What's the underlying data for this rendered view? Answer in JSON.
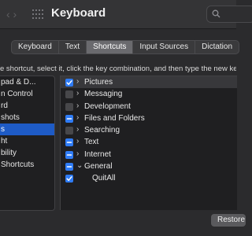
{
  "window": {
    "title": "Keyboard"
  },
  "tabs": [
    {
      "label": "Keyboard"
    },
    {
      "label": "Text"
    },
    {
      "label": "Shortcuts",
      "active": true
    },
    {
      "label": "Input Sources"
    },
    {
      "label": "Dictation"
    }
  ],
  "hint": "e shortcut, select it, click the key combination, and then type the new key",
  "left_list": [
    {
      "label": "pad & D..."
    },
    {
      "label": "n Control"
    },
    {
      "label": "rd"
    },
    {
      "label": "shots"
    },
    {
      "label": "s",
      "selected": true
    },
    {
      "label": "ht"
    },
    {
      "label": "bility"
    },
    {
      "label": "Shortcuts"
    }
  ],
  "right_list": [
    {
      "label": "Pictures",
      "state": "checked",
      "chevron": "›"
    },
    {
      "label": "Messaging",
      "state": "unchecked",
      "chevron": "›"
    },
    {
      "label": "Development",
      "state": "unchecked",
      "chevron": "›"
    },
    {
      "label": "Files and Folders",
      "state": "mixed",
      "chevron": "›"
    },
    {
      "label": "Searching",
      "state": "unchecked",
      "chevron": "›"
    },
    {
      "label": "Text",
      "state": "mixed",
      "chevron": "›"
    },
    {
      "label": "Internet",
      "state": "mixed",
      "chevron": "›"
    },
    {
      "label": "General",
      "state": "mixed",
      "chevron": "⌄"
    },
    {
      "label": "QuitAll",
      "state": "checked",
      "chevron": "",
      "child": true
    }
  ],
  "buttons": {
    "restore": "Restore Defaults"
  }
}
